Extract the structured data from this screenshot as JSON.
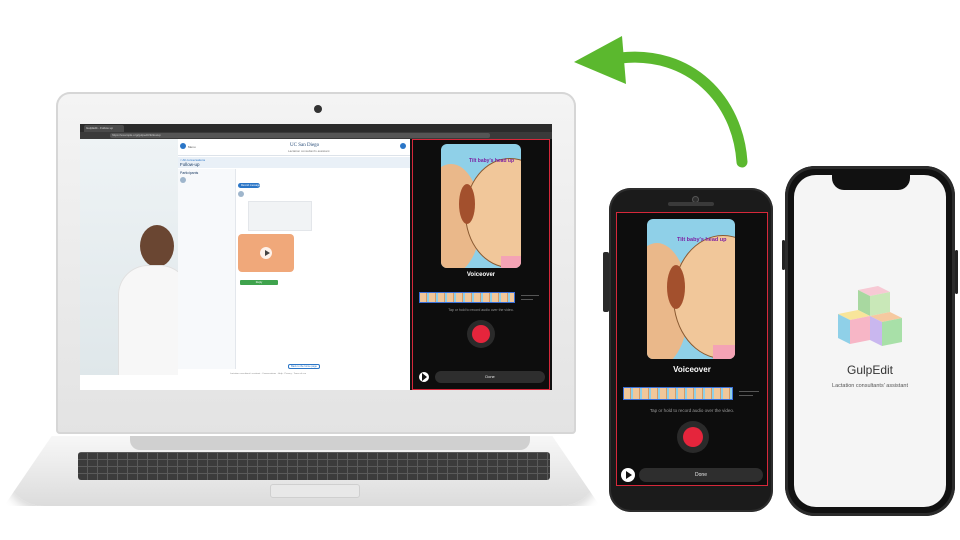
{
  "laptop": {
    "browser": {
      "tab_label": "GulpEdit - Follow up",
      "url": "https://example.org/gulpedit/followup"
    },
    "page": {
      "logo": "UC San Diego",
      "logo_sub": "Lactation consultant's assistant",
      "menu_label": "Menu",
      "breadcrumb": "< All conversations",
      "title": "Follow-up",
      "participants_label": "Participants",
      "message_pill": "Record message",
      "approve_button": "Reply",
      "back_button": "Back to the home page",
      "footer": "Lactation consultants' assistant · Conversations · Help · Privacy · Terms of use"
    },
    "panel": {
      "caption": "Tilt baby's head up",
      "voiceover_label": "Voiceover",
      "hint": "Tap or hold to record audio over the video.",
      "done_label": "Done"
    }
  },
  "android": {
    "caption": "Tilt baby's head up",
    "voiceover_label": "Voiceover",
    "hint": "Tap or hold to record audio over the video.",
    "done_label": "Done"
  },
  "iphone": {
    "app_name": "GulpEdit",
    "tagline": "Lactation consultants' assistant"
  },
  "colors": {
    "accent_green": "#5bb82e",
    "record_red": "#e5253c",
    "panel_border": "#d6283a",
    "brand_blue": "#2b76c7"
  },
  "icons": [
    "sync-arrow-icon",
    "play-icon",
    "record-icon",
    "gulpedit-blocks-logo"
  ]
}
